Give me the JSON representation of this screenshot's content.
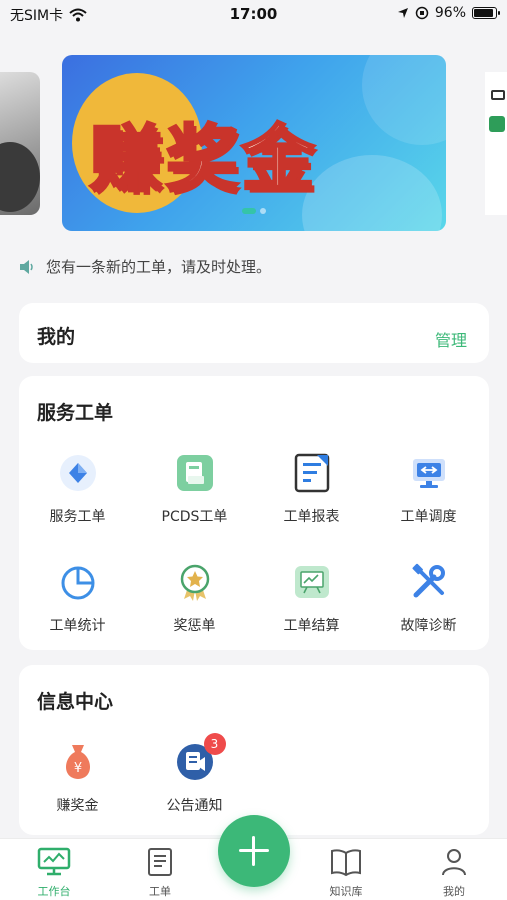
{
  "status_bar": {
    "carrier": "无SIM卡",
    "time": "17:00",
    "battery": "96%",
    "battery_level": 0.96
  },
  "banner": {
    "title": "赚奖金",
    "page_count": 2,
    "active_index": 1
  },
  "notice": {
    "text": "您有一条新的工单，请及时处理。"
  },
  "mine": {
    "title": "我的",
    "manage_label": "管理"
  },
  "service": {
    "title": "服务工单",
    "items": [
      {
        "label": "服务工单",
        "icon": "diamond-icon"
      },
      {
        "label": "PCDS工单",
        "icon": "pcds-icon"
      },
      {
        "label": "工单报表",
        "icon": "report-icon"
      },
      {
        "label": "工单调度",
        "icon": "dispatch-monitor-icon"
      },
      {
        "label": "工单统计",
        "icon": "pie-chart-icon"
      },
      {
        "label": "奖惩单",
        "icon": "award-medal-icon"
      },
      {
        "label": "工单结算",
        "icon": "settlement-board-icon"
      },
      {
        "label": "故障诊断",
        "icon": "wrench-screwdriver-icon"
      }
    ]
  },
  "info": {
    "title": "信息中心",
    "items": [
      {
        "label": "赚奖金",
        "icon": "money-bag-icon"
      },
      {
        "label": "公告通知",
        "icon": "announcement-icon",
        "badge": "3"
      }
    ]
  },
  "tabbar": {
    "items": [
      {
        "label": "工作台",
        "icon": "monitor-icon",
        "active": true
      },
      {
        "label": "工单",
        "icon": "document-icon",
        "active": false
      },
      {
        "label": "知识库",
        "icon": "book-icon",
        "active": false
      },
      {
        "label": "我的",
        "icon": "user-icon",
        "active": false
      }
    ],
    "fab_icon": "plus-icon"
  },
  "colors": {
    "accent": "#3cb878",
    "badge": "#ef4b4b",
    "banner_text_stroke": "#c9342b"
  }
}
